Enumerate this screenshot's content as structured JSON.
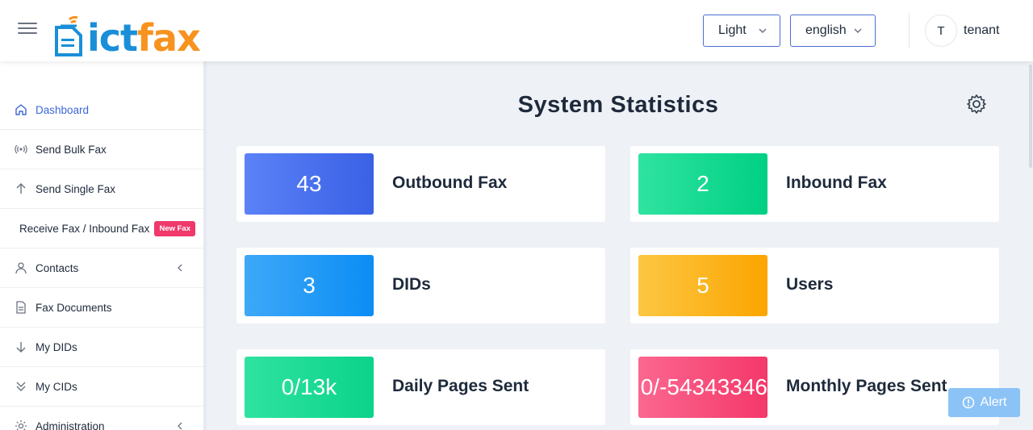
{
  "brand": {
    "logo_part1": "ict",
    "logo_part2": "fax",
    "logo_color1": "#1a8fd8",
    "logo_color2": "#f7931e"
  },
  "header": {
    "theme_select": {
      "value": "Light"
    },
    "language_select": {
      "value": "english"
    },
    "user": {
      "initial": "T",
      "name": "tenant"
    }
  },
  "sidebar": {
    "items": [
      {
        "label": "Dashboard",
        "icon": "home-icon",
        "active": true
      },
      {
        "label": "Send Bulk Fax",
        "icon": "broadcast-icon"
      },
      {
        "label": "Send Single Fax",
        "icon": "arrow-up-icon"
      },
      {
        "label": "Receive Fax / Inbound Fax",
        "badge": "New Fax"
      },
      {
        "label": "Contacts",
        "icon": "user-icon",
        "expandable": true
      },
      {
        "label": "Fax Documents",
        "icon": "document-icon"
      },
      {
        "label": "My DIDs",
        "icon": "arrow-down-icon"
      },
      {
        "label": "My CIDs",
        "icon": "double-chevron-down-icon"
      },
      {
        "label": "Administration",
        "icon": "gear-icon",
        "expandable": true
      }
    ]
  },
  "main": {
    "title": "System Statistics",
    "settings_icon": "gear-icon",
    "stats": [
      {
        "value": "43",
        "label": "Outbound Fax",
        "color": "#4a70ee"
      },
      {
        "value": "2",
        "label": "Inbound Fax",
        "color": "#17da93"
      },
      {
        "value": "3",
        "label": "DIDs",
        "color": "#259af6"
      },
      {
        "value": "5",
        "label": "Users",
        "color": "#fbb521"
      },
      {
        "value": "0/13k",
        "label": "Daily Pages Sent",
        "color": "#1ddb95"
      },
      {
        "value": "0/-54343346",
        "label": "Monthly Pages Sent",
        "color": "#f8507d"
      }
    ]
  },
  "alert": {
    "label": "Alert",
    "icon": "alert-circle-icon",
    "color": "#8cc3f7"
  }
}
